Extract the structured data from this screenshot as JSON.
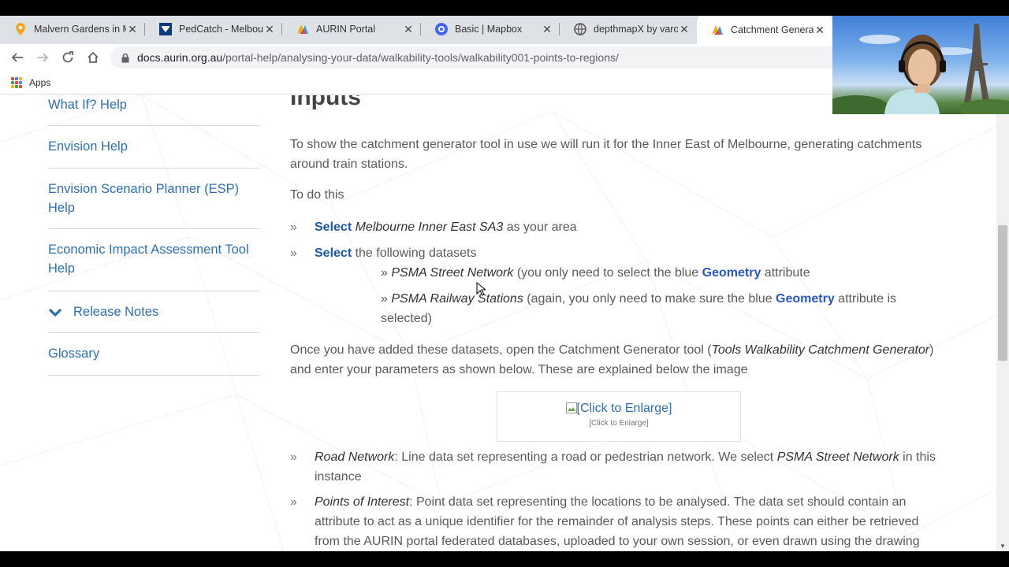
{
  "tabs": [
    {
      "title": "Malvern Gardens in M",
      "favicon": "map-pin-icon",
      "active": false
    },
    {
      "title": "PedCatch - Melbourn",
      "favicon": "university-icon",
      "active": false
    },
    {
      "title": "AURIN Portal",
      "favicon": "aurin-icon",
      "active": false
    },
    {
      "title": "Basic | Mapbox",
      "favicon": "mapbox-icon",
      "active": false
    },
    {
      "title": "depthmapX by varoud",
      "favicon": "globe-icon",
      "active": false
    },
    {
      "title": "Catchment Generator",
      "favicon": "aurin-icon",
      "active": true
    }
  ],
  "tab_close_glyph": "✕",
  "address": {
    "host": "docs.aurin.org.au",
    "path": "/portal-help/analysing-your-data/walkability-tools/walkability001-points-to-regions/"
  },
  "bookmarks": {
    "apps_label": "Apps"
  },
  "sidebar": {
    "items": [
      {
        "label": "What If? Help"
      },
      {
        "label": "Envision Help"
      },
      {
        "label": "Envision Scenario Planner (ESP) Help"
      },
      {
        "label": "Economic Impact Assessment Tool Help"
      },
      {
        "label": "Release Notes"
      },
      {
        "label": "Glossary"
      }
    ]
  },
  "content": {
    "heading": "Inputs",
    "intro": "To show the catchment generator tool in use we will run it for the Inner East of Melbourne, generating catchments around train stations.",
    "todo": "To do this",
    "bullet_mark": "»",
    "sub_mark": "»",
    "step1": {
      "select": "Select",
      "area": "Melbourne Inner East SA3",
      "rest": " as your area"
    },
    "step2": {
      "select": "Select",
      "rest": " the following datasets"
    },
    "sub1": {
      "name": "PSMA Street Network",
      "before": " (you only need to select the blue ",
      "geometry": "Geometry",
      "after": " attribute"
    },
    "sub2": {
      "name": "PSMA Railway Stations",
      "before": " (again, you only need to make sure the blue ",
      "geometry": "Geometry",
      "after": " attribute is selected)"
    },
    "para2": {
      "before": "Once you have added these datasets, open the Catchment Generator tool (",
      "tool_path": "Tools  Walkability  Catchment Generator",
      "after": ") and enter your parameters as shown below. These are explained below the image"
    },
    "enlarge": {
      "link": "[Click to Enlarge]",
      "caption": "[Click to Enlarge]"
    },
    "road": {
      "term": "Road Network",
      "text": ": Line data set representing a road or pedestrian network. We select ",
      "example": "PSMA Street Network",
      "tail": " in this instance"
    },
    "poi": {
      "term": "Points of Interest",
      "text": ": Point data set representing the locations to be analysed.  The data set should contain an attribute to act as a unique identifier for the remainder of analysis steps. These points can either be retrieved from the AURIN portal federated databases, uploaded to your own session, or even drawn using the drawing"
    }
  },
  "colors": {
    "link": "#2f6fb1",
    "select": "#1c5aa6",
    "geometry": "#2758c6"
  }
}
